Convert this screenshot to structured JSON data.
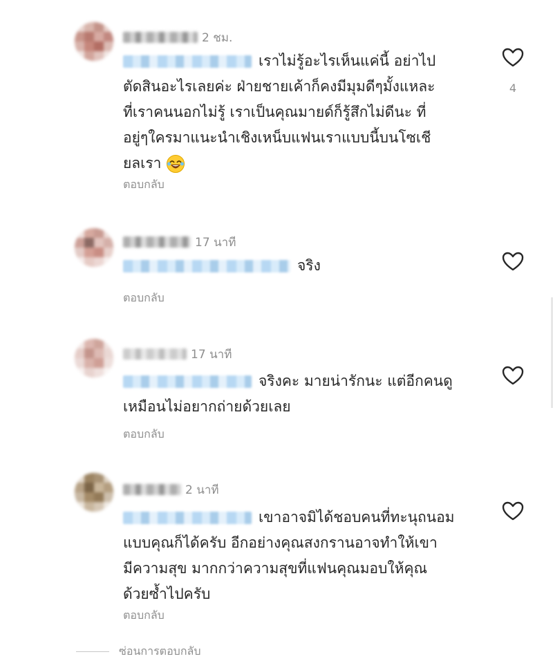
{
  "comments": [
    {
      "time": "2 ชม.",
      "text": "เราไม่รู้อะไรเห็นแค่นี้ อย่าไป\nตัดสินอะไรเลยค่ะ ฝ่ายชายเค้าก็คงมีมุมดีๆมั้งแหละ\nที่เราคนนอกไม่รู้ เราเป็นคุณมายด์ก็รู้สึกไม่ดีนะ ที่\nอยู่ๆใครมาแนะนำเชิงเหน็บแฟนเราแบบนี้บนโซเชี\nยลเรา",
      "emoji": "laughing-emoji",
      "reply_label": "ตอบกลับ",
      "likes": "4"
    },
    {
      "time": "17 นาที",
      "text": "จริง",
      "reply_label": "ตอบกลับ"
    },
    {
      "time": "17 นาที",
      "text": "จริงคะ มายน่ารักนะ แต่อีกคนดู\nเหมือนไม่อยากถ่ายด้วยเลย",
      "reply_label": "ตอบกลับ"
    },
    {
      "time": "2 นาที",
      "text": "เขาอาจมิได้ชอบคนที่ทะนุถนอม\nแบบคุณก็ได้ครับ อีกอย่างคุณสงกรานอาจทำให้เขา\nมีความสุข มากกว่าความสุขที่แฟนคุณมอบให้คุณ\nด้วยซ้ำไปครับ",
      "reply_label": "ตอบกลับ"
    }
  ],
  "hide_replies_label": "ซ่อนการตอบกลับ",
  "icons": {
    "like": "heart-outline-icon"
  },
  "colors": {
    "text": "#262626",
    "secondary": "#8e8e8e",
    "mention": "#00376b"
  }
}
